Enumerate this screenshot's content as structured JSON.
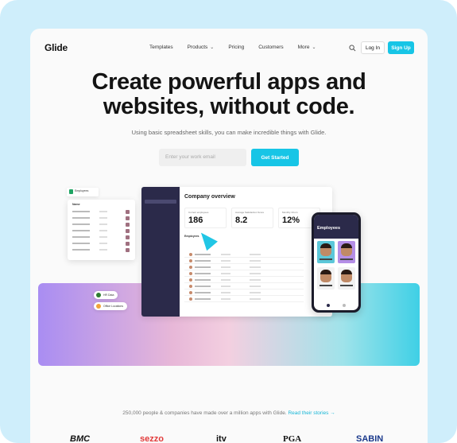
{
  "nav": {
    "logo": "Glide",
    "links": [
      {
        "label": "Templates",
        "dropdown": false
      },
      {
        "label": "Products",
        "dropdown": true
      },
      {
        "label": "Pricing",
        "dropdown": false
      },
      {
        "label": "Customers",
        "dropdown": false
      },
      {
        "label": "More",
        "dropdown": true
      }
    ],
    "login_label": "Log In",
    "signup_label": "Sign Up"
  },
  "hero": {
    "title_line1": "Create powerful apps and",
    "title_line2": "websites, without code.",
    "subtitle": "Using basic spreadsheet skills, you can make incredible things with Glide.",
    "email_placeholder": "Enter your work email",
    "cta_label": "Get Started"
  },
  "mockup": {
    "desktop_title": "Company overview",
    "stats": [
      {
        "label": "Current employees",
        "value": "186"
      },
      {
        "label": "Average Satisfaction Score",
        "value": "8.2"
      },
      {
        "label": "Monthly Churn",
        "value": "12%"
      }
    ],
    "section_label": "Employees",
    "sheet_tag": "Employees",
    "list_header": "Name",
    "pills": [
      "HR Data",
      "Office Locations"
    ],
    "phone_title": "Employees"
  },
  "social_proof": {
    "text": "250,000 people & companies have made over a million apps with Glide.",
    "link": "Read their stories →"
  },
  "logos": [
    "BMC",
    "sezzo",
    "itv",
    "PGA",
    "SABIN"
  ],
  "colors": {
    "accent": "#17c5e6",
    "frame": "#cfeefb",
    "sidebar": "#2b2a4a"
  }
}
